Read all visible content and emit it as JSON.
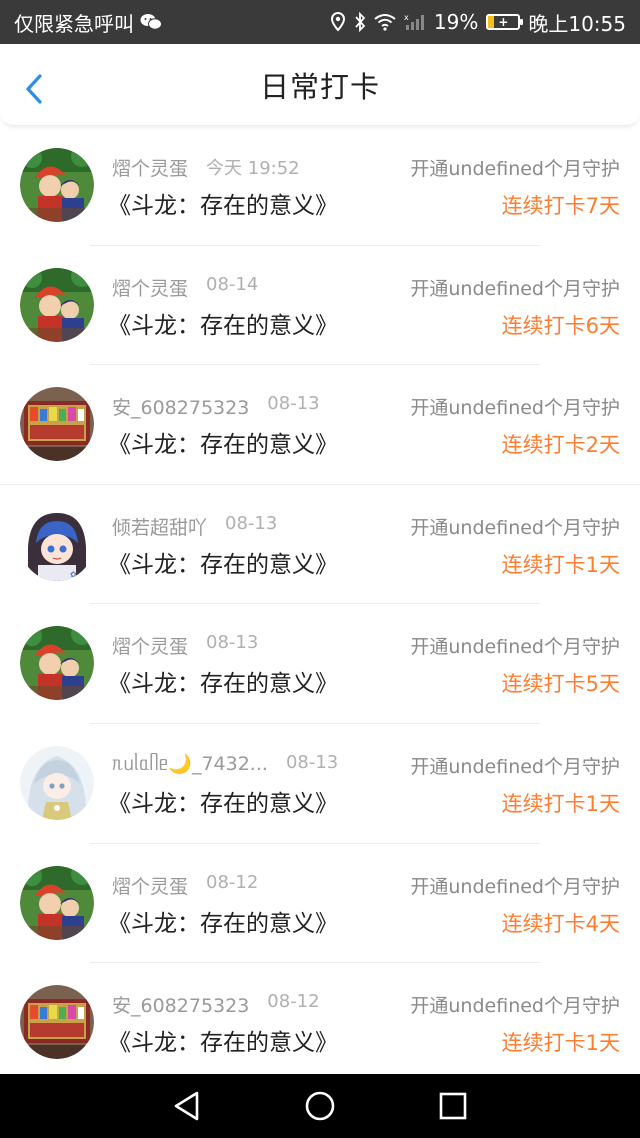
{
  "status_bar": {
    "carrier_text": "仅限紧急呼叫",
    "battery_percent": "19%",
    "battery_level": 0.19,
    "clock": "晚上10:55",
    "icons": [
      "wechat-icon",
      "location-icon",
      "bluetooth-icon",
      "wifi-icon",
      "signal-icon",
      "battery-icon"
    ]
  },
  "header": {
    "title": "日常打卡",
    "back_icon": "chevron-left-icon",
    "accent_color": "#2a8de9"
  },
  "rows": [
    {
      "name": "熠个灵蛋",
      "time": "今天 19:52",
      "book": "《斗龙：存在的意义》",
      "guard": "开通undefined个月守护",
      "streak": "连续打卡7天",
      "avatar": "red-hair-boy"
    },
    {
      "name": "熠个灵蛋",
      "time": "08-14",
      "book": "《斗龙：存在的意义》",
      "guard": "开通undefined个月守护",
      "streak": "连续打卡6天",
      "avatar": "red-hair-boy"
    },
    {
      "name": "安_608275323",
      "time": "08-13",
      "book": "《斗龙：存在的意义》",
      "guard": "开通undefined个月守护",
      "streak": "连续打卡2天",
      "avatar": "shelf-photo"
    },
    {
      "name": "倾若超甜吖",
      "time": "08-13",
      "book": "《斗龙：存在的意义》",
      "guard": "开通undefined个月守护",
      "streak": "连续打卡1天",
      "avatar": "blue-hair-girl"
    },
    {
      "name": "熠个灵蛋",
      "time": "08-13",
      "book": "《斗龙：存在的意义》",
      "guard": "开通undefined个月守护",
      "streak": "连续打卡5天",
      "avatar": "red-hair-boy"
    },
    {
      "name": "ᥰᥙᥣᥲᥥᥱ🌙_7432...",
      "time": "08-13",
      "book": "《斗龙：存在的意义》",
      "guard": "开通undefined个月守护",
      "streak": "连续打卡1天",
      "avatar": "silver-hair-girl"
    },
    {
      "name": "熠个灵蛋",
      "time": "08-12",
      "book": "《斗龙：存在的意义》",
      "guard": "开通undefined个月守护",
      "streak": "连续打卡4天",
      "avatar": "red-hair-boy"
    },
    {
      "name": "安_608275323",
      "time": "08-12",
      "book": "《斗龙：存在的意义》",
      "guard": "开通undefined个月守护",
      "streak": "连续打卡1天",
      "avatar": "shelf-photo"
    }
  ],
  "colors": {
    "streak": "#ff7d2e",
    "meta": "#9a9a9a",
    "status_bar": "#3a3a3a",
    "nav_bar": "#000000"
  },
  "nav_bar": {
    "buttons": [
      "back-triangle-icon",
      "home-circle-icon",
      "recents-square-icon"
    ]
  }
}
